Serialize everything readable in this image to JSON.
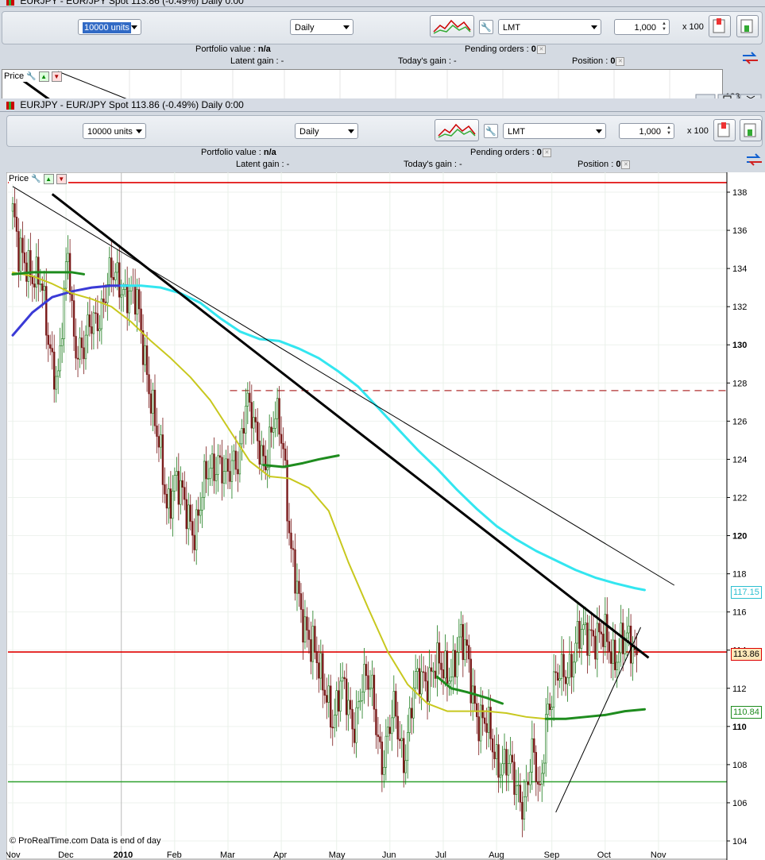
{
  "windows": {
    "back": {
      "title": "EURJPY - EUR/JPY Spot   113.86 (-0.49%)   Daily  0:00",
      "units": "10000 units",
      "period": "Daily",
      "order_type": "LMT",
      "quantity": "1,000",
      "multiplier": "x 100",
      "portfolio_label": "Portfolio value :",
      "portfolio_value": "n/a",
      "pending_label": "Pending orders :",
      "pending_value": "0",
      "latent_label": "Latent gain :",
      "latent_value": "-",
      "today_label": "Today's gain :",
      "today_value": "-",
      "position_label": "Position :",
      "position_value": "0",
      "price_tab": "Price",
      "price_tick": "128"
    },
    "front": {
      "title": "EURJPY - EUR/JPY Spot   113.86 (-0.49%)   Daily  0:00",
      "units": "10000 units",
      "period": "Daily",
      "order_type": "LMT",
      "quantity": "1,000",
      "multiplier": "x 100",
      "portfolio_label": "Portfolio value :",
      "portfolio_value": "n/a",
      "pending_label": "Pending orders :",
      "pending_value": "0",
      "latent_label": "Latent gain :",
      "latent_value": "-",
      "today_label": "Today's gain :",
      "today_value": "-",
      "position_label": "Position :",
      "position_value": "0",
      "price_tab": "Price"
    }
  },
  "footer": {
    "copyright": "© ProRealTime.com",
    "data_note": "Data is end of day"
  },
  "icons": {
    "wrench": "wrench-icon",
    "arrow_up": "arrow-up-icon",
    "arrow_down": "arrow-down-icon",
    "chart_tools": "chart-tools-icon",
    "buy_order": "buy-order-icon",
    "sell_order": "sell-order-icon",
    "swap": "swap-arrows-icon"
  },
  "colors": {
    "price_line_red": "#e00000",
    "support_green": "#2ea02e",
    "ma_yellow": "#c8c81e",
    "ma_cyan": "#33e6f0",
    "ma_green": "#1e8c1e",
    "ma_blue": "#3a3ad6",
    "trend_black": "#000000",
    "candle_up": "#1a7a1a",
    "candle_down": "#7a1a1a"
  },
  "chart_data": {
    "type": "line",
    "title": "EURJPY - EUR/JPY Spot",
    "xlabel": "",
    "ylabel": "",
    "ylim": [
      104,
      139
    ],
    "yticks": [
      104,
      106,
      108,
      110,
      112,
      114,
      116,
      118,
      120,
      122,
      124,
      126,
      128,
      130,
      132,
      134,
      136,
      138
    ],
    "xtick_labels": [
      "Nov",
      "Dec",
      "2010",
      "Feb",
      "Mar",
      "Apr",
      "May",
      "Jun",
      "Jul",
      "Aug",
      "Sep",
      "Oct",
      "Nov"
    ],
    "xtick_index": [
      0,
      27,
      55,
      82,
      109,
      136,
      164,
      191,
      218,
      245,
      273,
      300,
      327
    ],
    "grid": true,
    "last_price": 113.86,
    "last_price_label": "113.86",
    "ma_cyan_last_label": "117.15",
    "ma_green_last_label": "110.84",
    "horizontal_lines": [
      {
        "name": "resistance-top",
        "y": 138.5,
        "style": "solid",
        "color": "#e00000"
      },
      {
        "name": "current-price",
        "y": 113.9,
        "style": "solid",
        "color": "#e00000"
      },
      {
        "name": "support",
        "y": 107.1,
        "style": "solid",
        "color": "#2ea02e"
      },
      {
        "name": "dashed-resistance",
        "y": 127.6,
        "style": "dashed",
        "color": "#b03030",
        "x_from": 110
      }
    ],
    "trend_lines": [
      {
        "name": "thick-down-trend",
        "from": [
          20,
          137.9
        ],
        "to": [
          322,
          113.6
        ],
        "width": 3
      },
      {
        "name": "thin-down-trend",
        "from": [
          0,
          138.3
        ],
        "to": [
          335,
          117.4
        ],
        "width": 1
      },
      {
        "name": "thin-up-trend",
        "from": [
          275,
          105.5
        ],
        "to": [
          318,
          115.2
        ],
        "width": 1
      }
    ],
    "close_series": {
      "x": [
        0,
        3,
        8,
        14,
        18,
        23,
        28,
        31,
        36,
        43,
        48,
        54,
        58,
        63,
        68,
        73,
        78,
        82,
        87,
        92,
        97,
        104,
        109,
        114,
        118,
        123,
        128,
        133,
        137,
        141,
        146,
        152,
        157,
        162,
        166,
        169,
        172,
        177,
        182,
        187,
        193,
        198,
        203,
        208,
        213,
        218,
        222,
        226,
        230,
        236,
        240,
        245,
        250,
        255,
        259,
        263,
        267,
        270,
        274,
        277,
        280,
        283,
        286,
        289,
        293,
        297,
        300,
        304,
        308,
        312,
        316
      ],
      "y": [
        137.0,
        134.3,
        134.5,
        133.0,
        130.3,
        128.4,
        134.5,
        130.5,
        129.8,
        131.6,
        133.2,
        133.4,
        133.0,
        131.8,
        129.0,
        125.0,
        121.7,
        123.2,
        121.2,
        120.6,
        122.4,
        124.4,
        122.7,
        124.2,
        127.2,
        125.0,
        124.3,
        125.9,
        124.8,
        119.5,
        115.2,
        114.9,
        111.6,
        110.7,
        112.4,
        111.0,
        109.8,
        112.7,
        111.4,
        108.5,
        110.5,
        108.6,
        111.7,
        112.6,
        113.2,
        112.6,
        113.3,
        114.3,
        113.6,
        110.5,
        109.7,
        108.6,
        107.9,
        106.8,
        106.4,
        108.2,
        106.4,
        110.9,
        111.8,
        112.5,
        113.1,
        113.6,
        114.3,
        114.6,
        115.3,
        114.6,
        114.3,
        113.9,
        114.5,
        114.0,
        113.9
      ]
    },
    "series": [
      {
        "name": "ma-blue",
        "color": "#3a3ad6",
        "width": 3,
        "x": [
          0,
          10,
          20,
          30,
          40,
          50,
          58
        ],
        "y": [
          130.5,
          131.7,
          132.5,
          132.8,
          133.0,
          133.1,
          133.1
        ]
      },
      {
        "name": "ma-cyan",
        "color": "#33e6f0",
        "width": 3,
        "x": [
          55,
          65,
          75,
          85,
          95,
          105,
          115,
          125,
          135,
          145,
          155,
          165,
          175,
          185,
          195,
          205,
          215,
          225,
          235,
          245,
          255,
          265,
          275,
          285,
          295,
          305,
          315,
          320
        ],
        "y": [
          133.1,
          133.1,
          133.0,
          132.7,
          132.2,
          131.4,
          130.7,
          130.3,
          130.2,
          129.8,
          129.3,
          128.6,
          127.8,
          126.7,
          125.6,
          124.5,
          123.5,
          122.4,
          121.4,
          120.5,
          119.8,
          119.2,
          118.7,
          118.2,
          117.8,
          117.5,
          117.25,
          117.15
        ]
      },
      {
        "name": "ma-yellow",
        "color": "#c8c81e",
        "width": 2,
        "x": [
          0,
          10,
          20,
          30,
          40,
          50,
          60,
          70,
          80,
          90,
          100,
          110,
          120,
          130,
          140,
          150,
          160,
          170,
          180,
          190,
          200,
          210,
          220,
          230,
          240,
          250,
          260,
          270,
          275
        ],
        "y": [
          133.8,
          133.6,
          133.2,
          132.7,
          132.4,
          132.0,
          131.2,
          130.2,
          129.3,
          128.3,
          127.1,
          125.5,
          123.9,
          123.1,
          123.0,
          122.5,
          121.3,
          118.6,
          116.2,
          113.9,
          112.2,
          111.2,
          110.8,
          110.8,
          110.8,
          110.7,
          110.5,
          110.4,
          110.4
        ]
      },
      {
        "name": "ma-green",
        "color": "#1e8c1e",
        "width": 3,
        "x": [
          0,
          10,
          20,
          30,
          36
        ],
        "y": [
          133.7,
          133.8,
          133.8,
          133.8,
          133.7
        ]
      },
      {
        "name": "ma-green-2",
        "color": "#1e8c1e",
        "width": 3,
        "x": [
          127,
          137,
          147,
          155,
          160,
          165
        ],
        "y": [
          123.7,
          123.6,
          123.8,
          124.0,
          124.1,
          124.2
        ]
      },
      {
        "name": "ma-green-3",
        "color": "#1e8c1e",
        "width": 3,
        "x": [
          215,
          222,
          230,
          240,
          248
        ],
        "y": [
          112.6,
          112.0,
          111.8,
          111.5,
          111.2
        ]
      },
      {
        "name": "ma-green-4",
        "color": "#1e8c1e",
        "width": 3,
        "x": [
          270,
          280,
          290,
          300,
          310,
          320
        ],
        "y": [
          110.4,
          110.4,
          110.5,
          110.6,
          110.8,
          110.9
        ]
      }
    ]
  }
}
